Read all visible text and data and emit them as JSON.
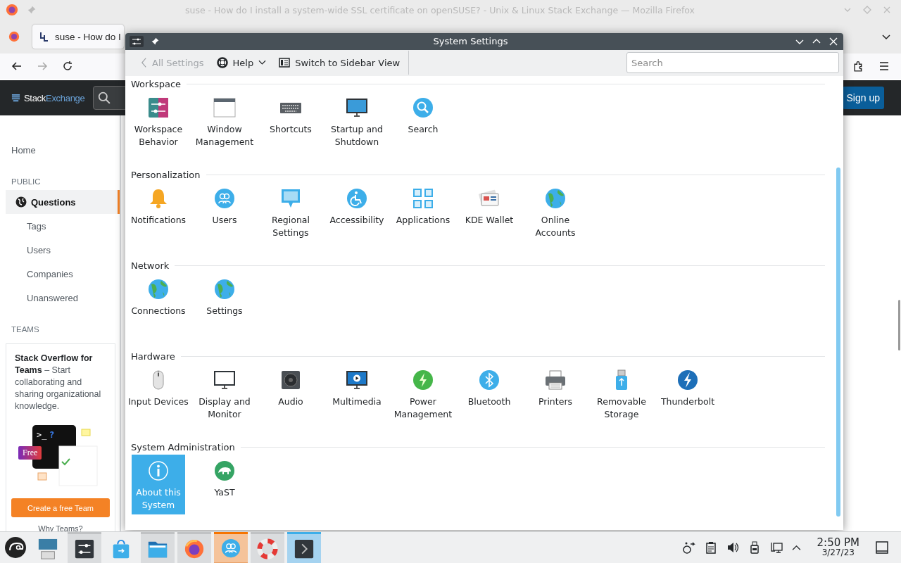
{
  "browser": {
    "title": "suse - How do I install a system-wide SSL certificate on openSUSE? - Unix & Linux Stack Exchange — Mozilla Firefox",
    "tab": "suse - How do I"
  },
  "site": {
    "logo": [
      {
        "text": "Stack",
        "kind": "plain"
      },
      {
        "text": "Exchange",
        "kind": "accent"
      }
    ],
    "signup": "Sign up",
    "nav": [
      {
        "kind": "link",
        "label": "Home",
        "selected": false
      },
      {
        "kind": "heading",
        "label": "PUBLIC"
      },
      {
        "kind": "link",
        "label": "Questions",
        "selected": true
      },
      {
        "kind": "sublink",
        "label": "Tags",
        "selected": false
      },
      {
        "kind": "sublink",
        "label": "Users",
        "selected": false
      },
      {
        "kind": "sublink",
        "label": "Companies",
        "selected": false
      },
      {
        "kind": "sublink",
        "label": "Unanswered",
        "selected": false
      },
      {
        "kind": "heading",
        "label": "TEAMS"
      }
    ],
    "teams": {
      "text": "**Stack Overflow for Teams** – Start collaborating and sharing organizational knowledge.",
      "badge": "Free",
      "prompt": ">_",
      "prompt_mark": "?",
      "button": "Create a free Team",
      "link": "Why Teams?"
    }
  },
  "settings": {
    "title": "System Settings",
    "back": {
      "label": "All Settings",
      "disabled": true
    },
    "help": "Help",
    "switch": "Switch to Sidebar View",
    "search": {
      "placeholder": "Search"
    },
    "categories": [
      {
        "name": "Workspace",
        "items": [
          {
            "label": "Workspace Behavior",
            "selected": false
          },
          {
            "label": "Window Management",
            "selected": false
          },
          {
            "label": "Shortcuts",
            "selected": false
          },
          {
            "label": "Startup and Shutdown",
            "selected": false
          },
          {
            "label": "Search",
            "selected": false
          }
        ]
      },
      {
        "name": "Personalization",
        "items": [
          {
            "label": "Notifications",
            "selected": false
          },
          {
            "label": "Users",
            "selected": false
          },
          {
            "label": "Regional Settings",
            "selected": false
          },
          {
            "label": "Accessibility",
            "selected": false
          },
          {
            "label": "Applications",
            "selected": false
          },
          {
            "label": "KDE Wallet",
            "selected": false
          },
          {
            "label": "Online Accounts",
            "selected": false
          }
        ]
      },
      {
        "name": "Network",
        "items": [
          {
            "label": "Connections",
            "selected": false
          },
          {
            "label": "Settings",
            "selected": false
          }
        ]
      },
      {
        "name": "Hardware",
        "items": [
          {
            "label": "Input Devices",
            "selected": false
          },
          {
            "label": "Display and Monitor",
            "selected": false
          },
          {
            "label": "Audio",
            "selected": false
          },
          {
            "label": "Multimedia",
            "selected": false
          },
          {
            "label": "Power Management",
            "selected": false
          },
          {
            "label": "Bluetooth",
            "selected": false
          },
          {
            "label": "Printers",
            "selected": false
          },
          {
            "label": "Removable Storage",
            "selected": false
          },
          {
            "label": "Thunderbolt",
            "selected": false
          }
        ]
      },
      {
        "name": "System Administration",
        "items": [
          {
            "label": "About this System",
            "selected": true
          },
          {
            "label": "YaST",
            "selected": false
          }
        ]
      }
    ]
  },
  "taskbar": {
    "tasks": [
      {
        "open": false,
        "active": false,
        "attention": false
      },
      {
        "open": true,
        "active": false,
        "attention": false
      },
      {
        "open": false,
        "active": false,
        "attention": false
      },
      {
        "open": true,
        "active": false,
        "attention": false
      },
      {
        "open": true,
        "active": false,
        "attention": false
      },
      {
        "open": true,
        "active": false,
        "attention": true
      },
      {
        "open": true,
        "active": false,
        "attention": false
      },
      {
        "open": true,
        "active": true,
        "attention": false
      }
    ],
    "time": "2:50 PM",
    "date": "3/27/23"
  }
}
